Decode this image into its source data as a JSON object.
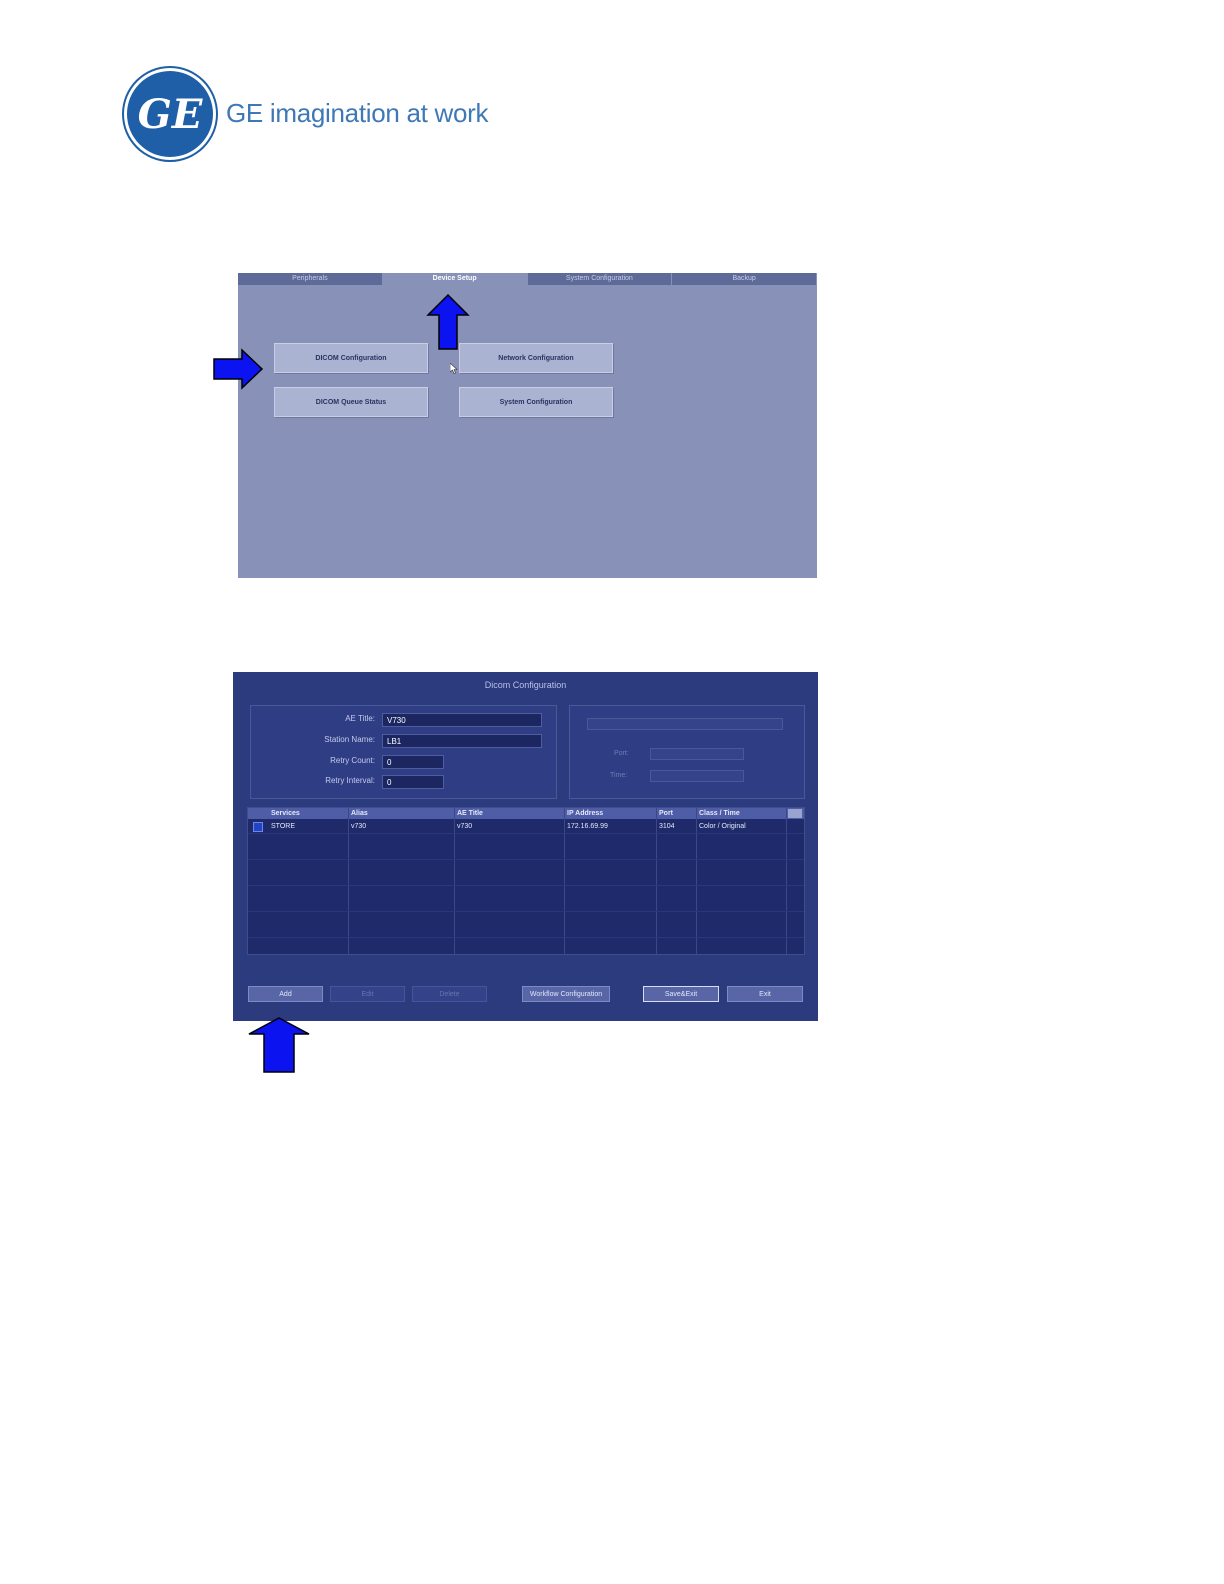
{
  "header": {
    "logo_text": "GE",
    "tagline": "GE imagination at work"
  },
  "device_setup_screen": {
    "tabs": [
      {
        "label": "Peripherals"
      },
      {
        "label": "Device Setup"
      },
      {
        "label": "System Configuration"
      },
      {
        "label": "Backup"
      }
    ],
    "active_tab": 1,
    "buttons": {
      "dicom_configuration": "DICOM Configuration",
      "network_configuration": "Network Configuration",
      "dicom_queue_status": "DICOM Queue Status",
      "system_configuration": "System Configuration"
    }
  },
  "dicom_configuration_screen": {
    "title": "Dicom Configuration",
    "form": {
      "ae_title_label": "AE Title:",
      "ae_title_value": "V730",
      "station_name_label": "Station Name:",
      "station_name_value": "LB1",
      "retry_count_label": "Retry Count:",
      "retry_count_value": "0",
      "retry_interval_label": "Retry Interval:",
      "retry_interval_value": "0"
    },
    "right_panel": {
      "field1_label": "Port:",
      "field2_label": "Time:"
    },
    "table": {
      "columns": [
        "Services",
        "Alias",
        "AE Title",
        "IP Address",
        "Port",
        "Class / Time"
      ],
      "rows": [
        {
          "services": "STORE",
          "alias": "v730",
          "ae_title": "v730",
          "ip_address": "172.16.69.99",
          "port": "3104",
          "class_time": "Color / Original"
        }
      ]
    },
    "buttons": {
      "add": "Add",
      "edit": "Edit",
      "delete": "Delete",
      "workflow_configuration": "Workflow Configuration",
      "save_exit": "Save&Exit",
      "exit": "Exit"
    }
  },
  "colors": {
    "arrow_fill": "#0b14f0",
    "arrow_stroke": "#000000",
    "screen1_bg": "#8892b8",
    "screen2_bg": "#2c3a7e",
    "tagline": "#3f78b6"
  }
}
